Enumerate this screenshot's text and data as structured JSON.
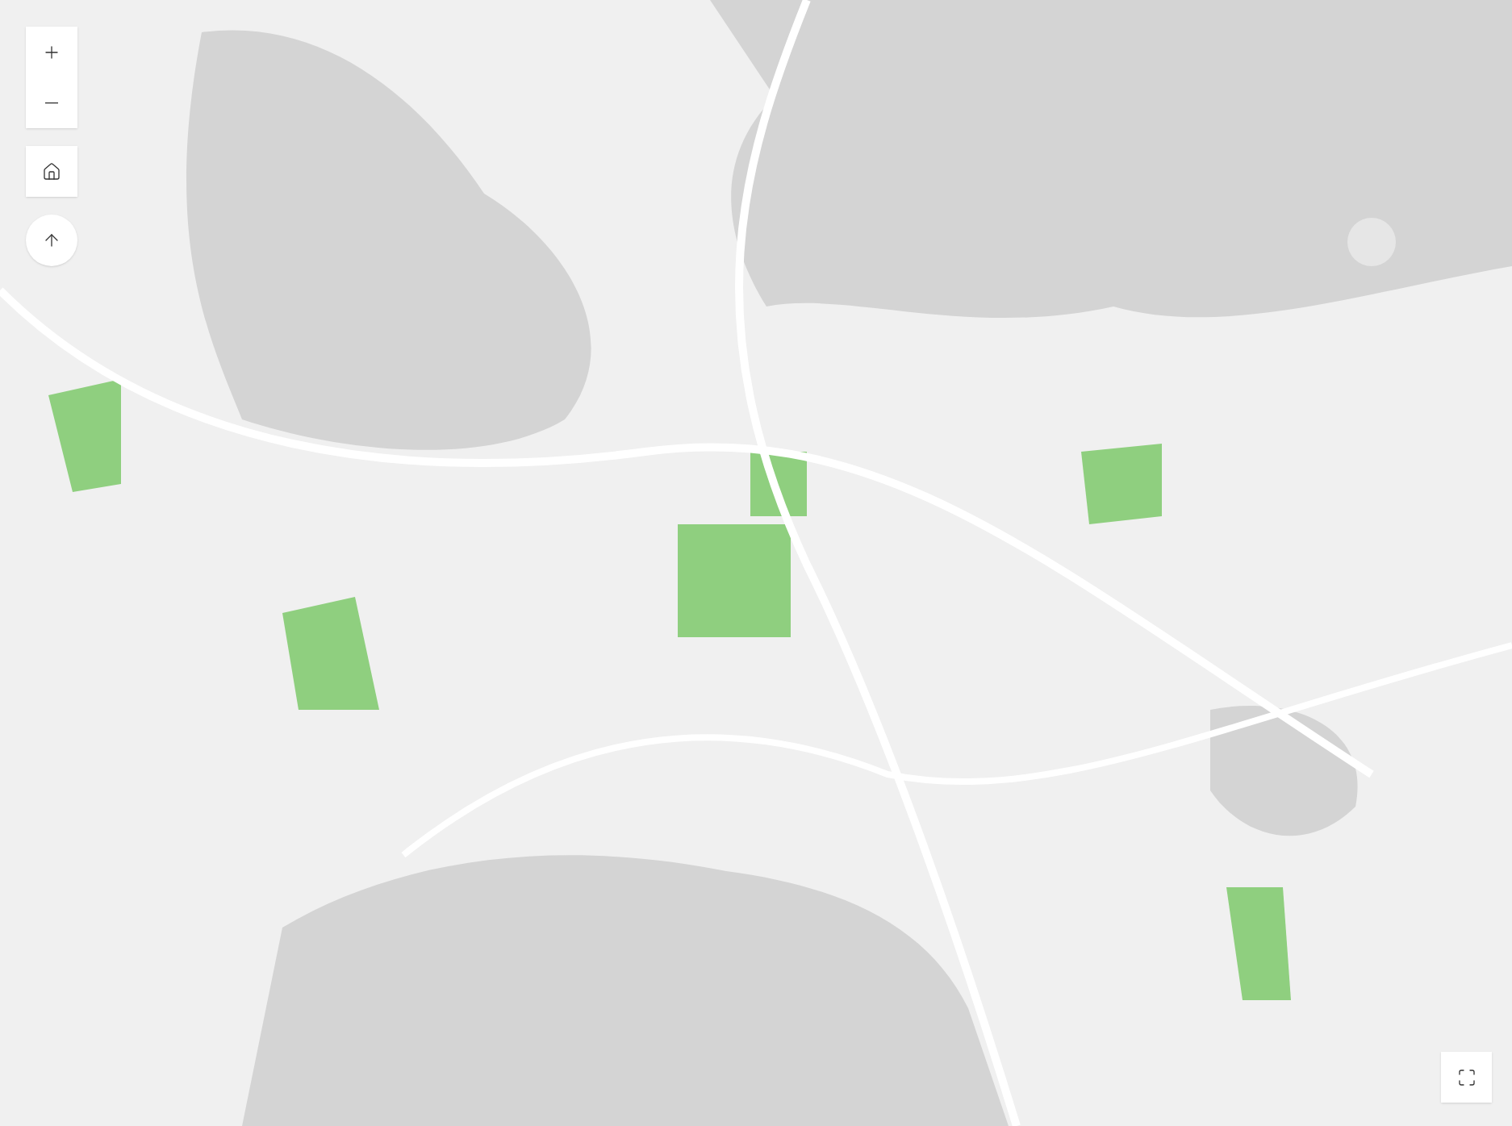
{
  "controls": [
    {
      "kind": "zoom_in"
    },
    {
      "kind": "zoom_out"
    },
    {
      "kind": "home"
    },
    {
      "kind": "compass"
    },
    {
      "kind": "fullscreen"
    }
  ]
}
